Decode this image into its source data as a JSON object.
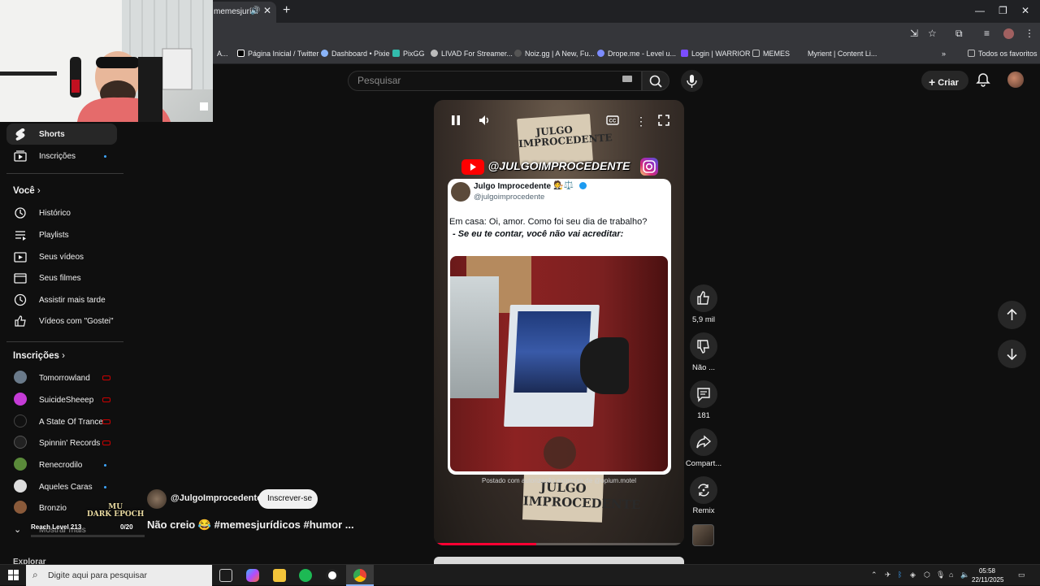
{
  "browser": {
    "tab_title": "memesjurídi",
    "bookmarks": [
      {
        "label": "A...",
        "color": "#888888"
      },
      {
        "label": "Página Inicial / Twitter",
        "color": "#ffffff"
      },
      {
        "label": "Dashboard • Pixie",
        "color": "#8ab4f8"
      },
      {
        "label": "PixGG",
        "color": "#32bcad"
      },
      {
        "label": "LIVAD For Streamer...",
        "color": "#bbbbbb"
      },
      {
        "label": "Noiz.gg | A New, Fu...",
        "color": "#555555"
      },
      {
        "label": "Drope.me - Level u...",
        "color": "#7c8cff"
      },
      {
        "label": "Login | WARRIOR",
        "color": "#7b4dff"
      },
      {
        "label": "MEMES",
        "color": "#bbbbbb"
      },
      {
        "label": "Myrient | Content Li...",
        "color": "#888888"
      }
    ],
    "all_bookmarks": "Todos os favoritos"
  },
  "header": {
    "search_placeholder": "Pesquisar",
    "create_label": "Criar"
  },
  "sidebar": {
    "top_items": [
      {
        "label": "Shorts",
        "active": true,
        "icon": "shorts-icon"
      },
      {
        "label": "Inscrições",
        "active": false,
        "icon": "subscriptions-icon",
        "dot": true
      }
    ],
    "you_heading": "Você",
    "you_items": [
      {
        "label": "Histórico",
        "icon": "history-icon"
      },
      {
        "label": "Playlists",
        "icon": "playlists-icon"
      },
      {
        "label": "Seus vídeos",
        "icon": "your-videos-icon"
      },
      {
        "label": "Seus filmes",
        "icon": "your-movies-icon"
      },
      {
        "label": "Assistir mais tarde",
        "icon": "watch-later-icon"
      },
      {
        "label": "Vídeos com \"Gostei\"",
        "icon": "liked-videos-icon"
      }
    ],
    "subs_heading": "Inscrições",
    "subscriptions": [
      {
        "label": "Tomorrowland",
        "status": "live",
        "color": "#6a7a8a"
      },
      {
        "label": "SuicideSheeep",
        "status": "live",
        "color": "#c43bd6"
      },
      {
        "label": "A State Of Trance",
        "status": "live",
        "color": "#111111"
      },
      {
        "label": "Spinnin' Records",
        "status": "live",
        "color": "#222222"
      },
      {
        "label": "Renecrodilo",
        "status": "new",
        "color": "#5a8a3a"
      },
      {
        "label": "Aqueles Caras",
        "status": "new",
        "color": "#dddddd"
      },
      {
        "label": "Bronzio",
        "status": "none",
        "color": "#8a5a3a"
      }
    ],
    "show_more": "Mostrar mais",
    "explore_heading": "Explorar"
  },
  "player": {
    "sign_text": "JULGO IMPROCEDENTE",
    "banner_handle": "@JULGOIMPROCEDENTE",
    "tweet": {
      "name": "Julgo Improcedente",
      "handle": "@julgoimprocedente",
      "line1": "Em casa: Oi, amor. Como foi seu dia de trabalho?",
      "line2": "- Se eu te contar, você não vai acreditar:"
    },
    "watermark": "Postado com autorização expressa de @opium.motel",
    "progress_fraction": 0.41
  },
  "actions": {
    "likes": "5,9 mil",
    "dislike": "Não ...",
    "comments": "181",
    "share": "Compart...",
    "remix": "Remix"
  },
  "video": {
    "channel": "@JulgoImprocedente",
    "subscribe_label": "Inscrever-se",
    "title": "Não creio 😂 #memesjurídicos #humor ..."
  },
  "overlay": {
    "game_title": "MU\nDARK EPOCH",
    "reach": "Reach Level 213",
    "counter": "0/20"
  },
  "taskbar": {
    "search_placeholder": "Digite aqui para pesquisar",
    "time": "05:58",
    "date": "22/11/2025"
  }
}
